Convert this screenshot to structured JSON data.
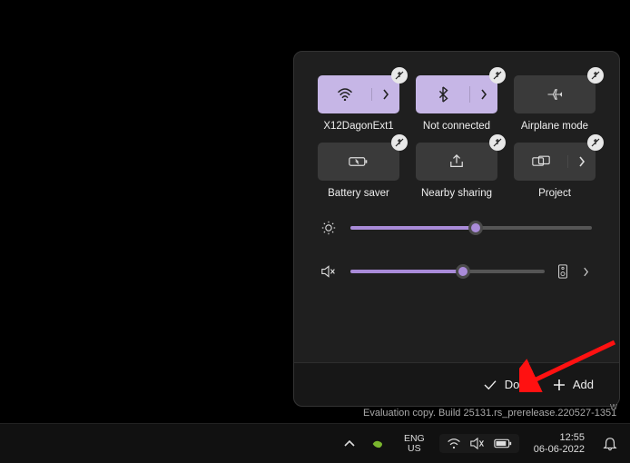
{
  "quick_settings": {
    "tiles": [
      {
        "name": "wifi",
        "label": "X12DagonExt1",
        "active": true,
        "split": true,
        "icon": "wifi"
      },
      {
        "name": "bluetooth",
        "label": "Not connected",
        "active": true,
        "split": true,
        "icon": "bluetooth"
      },
      {
        "name": "airplane",
        "label": "Airplane mode",
        "active": false,
        "split": false,
        "icon": "airplane"
      },
      {
        "name": "battery-saver",
        "label": "Battery saver",
        "active": false,
        "split": false,
        "icon": "battery"
      },
      {
        "name": "nearby",
        "label": "Nearby sharing",
        "active": false,
        "split": false,
        "icon": "share"
      },
      {
        "name": "project",
        "label": "Project",
        "active": false,
        "split": true,
        "icon": "project"
      }
    ],
    "brightness": {
      "percent": 52,
      "icon": "brightness"
    },
    "volume": {
      "percent": 58,
      "icon": "volume-mute",
      "output_icon": "speaker-device"
    },
    "footer": {
      "done": "Done",
      "add": "Add"
    }
  },
  "desktop": {
    "watermark": "Evaluation copy. Build 25131.rs_prerelease.220527-1351",
    "w": "w"
  },
  "taskbar": {
    "lang_top": "ENG",
    "lang_bottom": "US",
    "time": "12:55",
    "date": "06-06-2022"
  }
}
